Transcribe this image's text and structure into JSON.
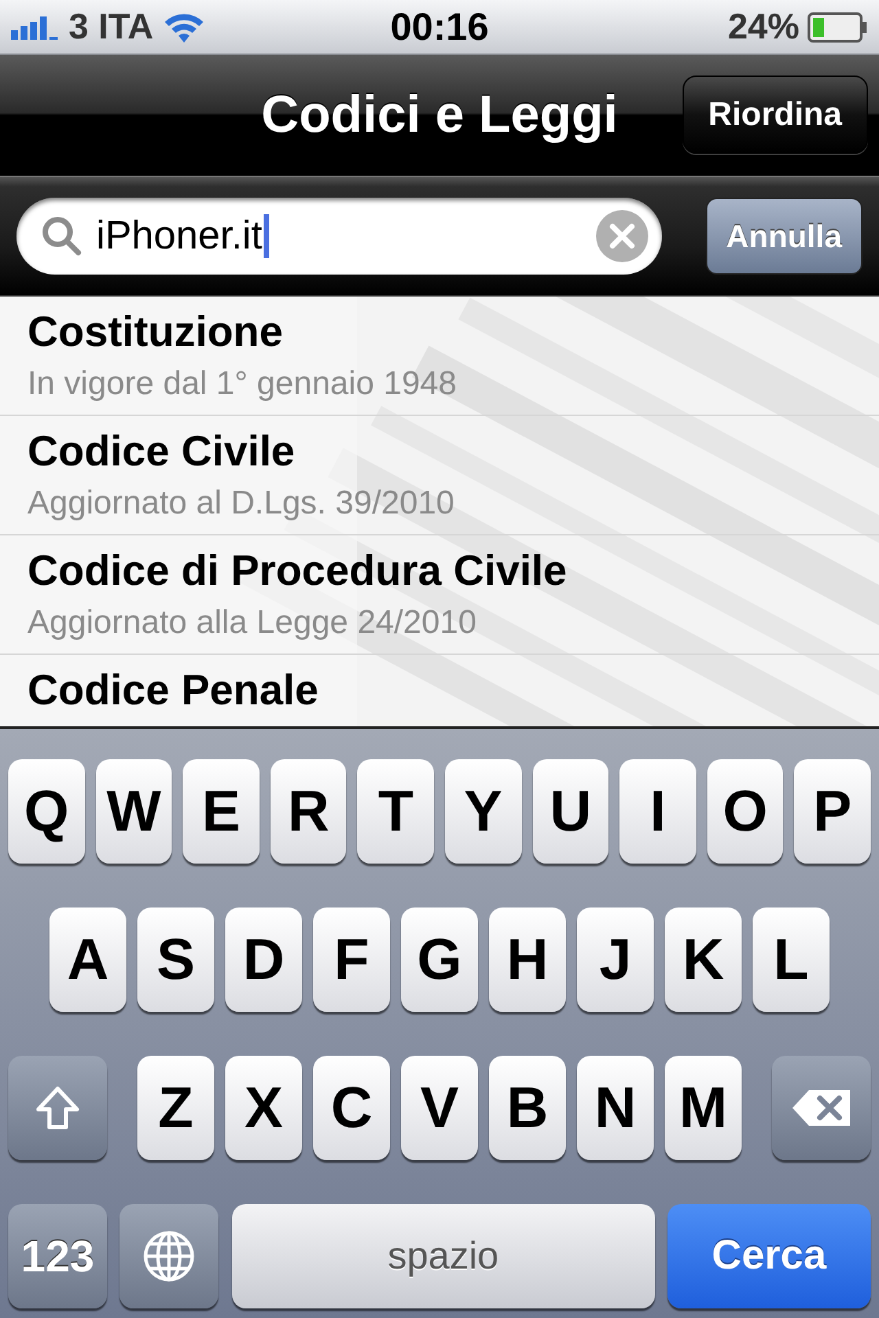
{
  "status_bar": {
    "carrier": "3 ITA",
    "time": "00:16",
    "battery": "24%"
  },
  "nav_bar": {
    "title": "Codici e Leggi",
    "right_button": "Riordina"
  },
  "search": {
    "value": "iPhoner.it",
    "cancel_button": "Annulla"
  },
  "list": [
    {
      "title": "Costituzione",
      "subtitle": "In vigore dal 1° gennaio 1948"
    },
    {
      "title": "Codice Civile",
      "subtitle": "Aggiornato al D.Lgs. 39/2010"
    },
    {
      "title": "Codice di Procedura Civile",
      "subtitle": "Aggiornato alla Legge 24/2010"
    },
    {
      "title": "Codice Penale"
    }
  ],
  "keyboard": {
    "rows": [
      {
        "keys": [
          {
            "kind": "letter",
            "label": "Q"
          },
          {
            "kind": "letter",
            "label": "W"
          },
          {
            "kind": "letter",
            "label": "E"
          },
          {
            "kind": "letter",
            "label": "R"
          },
          {
            "kind": "letter",
            "label": "T"
          },
          {
            "kind": "letter",
            "label": "Y"
          },
          {
            "kind": "letter",
            "label": "U"
          },
          {
            "kind": "letter",
            "label": "I"
          },
          {
            "kind": "letter",
            "label": "O"
          },
          {
            "kind": "letter",
            "label": "P"
          }
        ]
      },
      {
        "keys": [
          {
            "kind": "letter",
            "label": "A"
          },
          {
            "kind": "letter",
            "label": "S"
          },
          {
            "kind": "letter",
            "label": "D"
          },
          {
            "kind": "letter",
            "label": "F"
          },
          {
            "kind": "letter",
            "label": "G"
          },
          {
            "kind": "letter",
            "label": "H"
          },
          {
            "kind": "letter",
            "label": "J"
          },
          {
            "kind": "letter",
            "label": "K"
          },
          {
            "kind": "letter",
            "label": "L"
          }
        ]
      },
      {
        "keys": [
          {
            "kind": "shift"
          },
          {
            "kind": "letter",
            "label": "Z"
          },
          {
            "kind": "letter",
            "label": "X"
          },
          {
            "kind": "letter",
            "label": "C"
          },
          {
            "kind": "letter",
            "label": "V"
          },
          {
            "kind": "letter",
            "label": "B"
          },
          {
            "kind": "letter",
            "label": "N"
          },
          {
            "kind": "letter",
            "label": "M"
          },
          {
            "kind": "backspace"
          }
        ]
      },
      {
        "keys": [
          {
            "kind": "numbers",
            "label": "123"
          },
          {
            "kind": "globe"
          },
          {
            "kind": "space",
            "label": "spazio"
          },
          {
            "kind": "search",
            "label": "Cerca"
          }
        ]
      }
    ]
  }
}
